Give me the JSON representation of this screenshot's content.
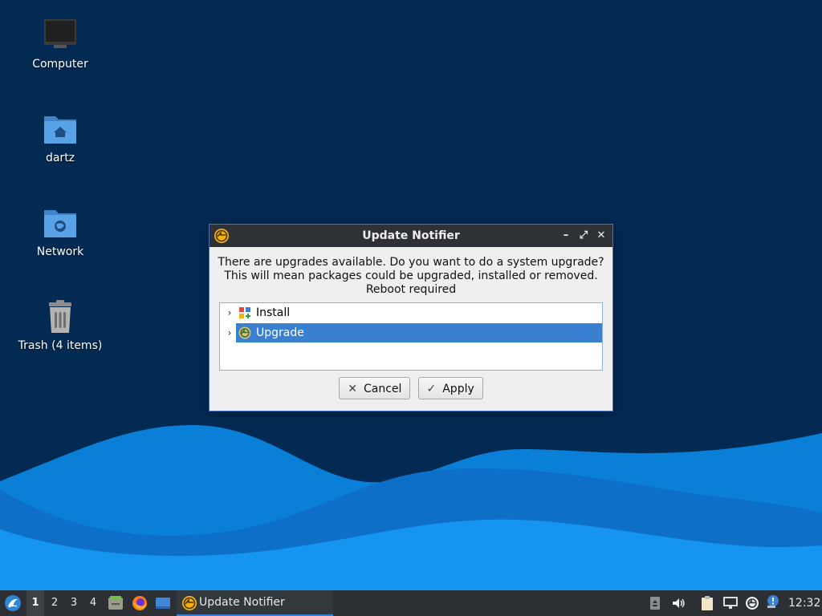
{
  "desktop": {
    "icons": [
      {
        "label": "Computer",
        "icon": "computer-icon"
      },
      {
        "label": "dartz",
        "icon": "home-folder-icon"
      },
      {
        "label": "Network",
        "icon": "network-folder-icon"
      },
      {
        "label": "Trash (4 items)",
        "icon": "trash-icon"
      }
    ]
  },
  "dialog": {
    "title": "Update Notifier",
    "message_lines": [
      "There are upgrades available. Do you want to do a system upgrade?",
      "This will mean packages could be upgraded, installed or removed.",
      "Reboot required"
    ],
    "tree": [
      {
        "label": "Install",
        "icon": "install-packages-icon",
        "selected": false
      },
      {
        "label": "Upgrade",
        "icon": "upgrade-icon",
        "selected": true
      }
    ],
    "buttons": {
      "cancel_label": "Cancel",
      "apply_label": "Apply"
    },
    "window_controls": [
      "minimize-icon",
      "maximize-icon",
      "close-icon"
    ]
  },
  "taskbar": {
    "workspaces": [
      "1",
      "2",
      "3",
      "4"
    ],
    "active_workspace": "1",
    "task_label": "Update Notifier",
    "clock": "12:32"
  },
  "colors": {
    "desktop_background": "#022a52",
    "selection": "#3a80d0",
    "taskbar": "#2c3034",
    "titlebar": "#2e3236"
  }
}
